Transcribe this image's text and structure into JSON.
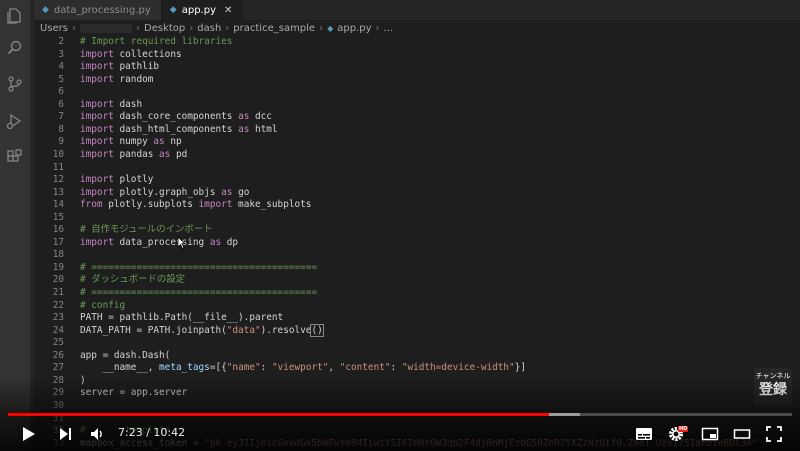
{
  "activity_bar": {
    "icons": [
      "files-icon",
      "search-icon",
      "source-control-icon",
      "run-debug-icon",
      "extensions-icon"
    ]
  },
  "tabs": [
    {
      "label": "data_processing.py",
      "active": false
    },
    {
      "label": "app.py",
      "active": true
    }
  ],
  "breadcrumb": {
    "items": [
      "Users",
      "Desktop",
      "dash",
      "practice_sample",
      "app.py",
      "..."
    ]
  },
  "editor": {
    "lines": [
      {
        "n": "2",
        "t": [
          [
            "cm",
            "# Import required libraries"
          ]
        ]
      },
      {
        "n": "3",
        "t": [
          [
            "kw",
            "import"
          ],
          [
            "pl",
            " collections"
          ]
        ]
      },
      {
        "n": "4",
        "t": [
          [
            "kw",
            "import"
          ],
          [
            "pl",
            " pathlib"
          ]
        ]
      },
      {
        "n": "5",
        "t": [
          [
            "kw",
            "import"
          ],
          [
            "pl",
            " random"
          ]
        ]
      },
      {
        "n": "6",
        "t": []
      },
      {
        "n": "6",
        "t": [
          [
            "kw",
            "import"
          ],
          [
            "pl",
            " dash"
          ]
        ]
      },
      {
        "n": "7",
        "t": [
          [
            "kw",
            "import"
          ],
          [
            "pl",
            " dash_core_components "
          ],
          [
            "kw",
            "as"
          ],
          [
            "pl",
            " dcc"
          ]
        ]
      },
      {
        "n": "8",
        "t": [
          [
            "kw",
            "import"
          ],
          [
            "pl",
            " dash_html_components "
          ],
          [
            "kw",
            "as"
          ],
          [
            "pl",
            " html"
          ]
        ]
      },
      {
        "n": "9",
        "t": [
          [
            "kw",
            "import"
          ],
          [
            "pl",
            " numpy "
          ],
          [
            "kw",
            "as"
          ],
          [
            "pl",
            " np"
          ]
        ]
      },
      {
        "n": "10",
        "t": [
          [
            "kw",
            "import"
          ],
          [
            "pl",
            " pandas "
          ],
          [
            "kw",
            "as"
          ],
          [
            "pl",
            " pd"
          ]
        ]
      },
      {
        "n": "11",
        "t": []
      },
      {
        "n": "12",
        "t": [
          [
            "kw",
            "import"
          ],
          [
            "pl",
            " plotly"
          ]
        ]
      },
      {
        "n": "13",
        "t": [
          [
            "kw",
            "import"
          ],
          [
            "pl",
            " plotly.graph_objs "
          ],
          [
            "kw",
            "as"
          ],
          [
            "pl",
            " go"
          ]
        ]
      },
      {
        "n": "14",
        "t": [
          [
            "kw",
            "from"
          ],
          [
            "pl",
            " plotly.subplots "
          ],
          [
            "kw",
            "import"
          ],
          [
            "pl",
            " make_subplots"
          ]
        ]
      },
      {
        "n": "15",
        "t": []
      },
      {
        "n": "16",
        "t": [
          [
            "cm",
            "# 自作モジュールのインポート"
          ]
        ]
      },
      {
        "n": "17",
        "t": [
          [
            "kw",
            "import"
          ],
          [
            "pl",
            " data_processing "
          ],
          [
            "kw",
            "as"
          ],
          [
            "pl",
            " dp"
          ]
        ]
      },
      {
        "n": "18",
        "t": []
      },
      {
        "n": "19",
        "t": [
          [
            "cm",
            "# ========================================"
          ]
        ]
      },
      {
        "n": "20",
        "t": [
          [
            "cm",
            "# ダッシュボードの設定"
          ]
        ]
      },
      {
        "n": "21",
        "t": [
          [
            "cm",
            "# ========================================"
          ]
        ]
      },
      {
        "n": "22",
        "t": [
          [
            "cm",
            "# config"
          ]
        ]
      },
      {
        "n": "23",
        "t": [
          [
            "pl",
            "PATH = pathlib.Path(__file__).parent"
          ]
        ]
      },
      {
        "n": "24",
        "t": [
          [
            "pl",
            "DATA_PATH = PATH.joinpath("
          ],
          [
            "st",
            "\"data\""
          ],
          [
            "pl",
            ").resolve"
          ],
          [
            "bx",
            "()"
          ]
        ]
      },
      {
        "n": "25",
        "t": []
      },
      {
        "n": "26",
        "t": [
          [
            "pl",
            "app = dash.Dash("
          ]
        ]
      },
      {
        "n": "27",
        "t": [
          [
            "pl",
            "    __name__, "
          ],
          [
            "va",
            "meta_tags"
          ],
          [
            "pl",
            "=[{"
          ],
          [
            "st",
            "\"name\""
          ],
          [
            "pl",
            ": "
          ],
          [
            "st",
            "\"viewport\""
          ],
          [
            "pl",
            ", "
          ],
          [
            "st",
            "\"content\""
          ],
          [
            "pl",
            ": "
          ],
          [
            "st",
            "\"width=device-width\""
          ],
          [
            "pl",
            "}]"
          ]
        ]
      },
      {
        "n": "28",
        "t": [
          [
            "pl",
            ")"
          ]
        ]
      },
      {
        "n": "29",
        "t": [
          [
            "pl",
            "server = app.server"
          ]
        ]
      },
      {
        "n": "30",
        "t": []
      },
      {
        "n": "31",
        "t": []
      },
      {
        "n": "32",
        "t": [
          [
            "cm",
            "# "
          ],
          [
            "cm",
            "      template"
          ]
        ]
      },
      {
        "n": "33",
        "t": [
          [
            "pl",
            "mapbox_access_token = "
          ],
          [
            "st",
            "\"pk.eyJ1IjoicGxvdGx5bWFwYm94IiwiYSI6ImNrOWJqb2F4djBnMjEzbG50ZnR2YXZzNzQifQ.Zme1-Uzoi75IaFbieBDl3A\""
          ]
        ]
      }
    ]
  },
  "watermark": {
    "top": "チャンネル",
    "main": "登録"
  },
  "player": {
    "time_current": "7:23",
    "time_sep": " / ",
    "time_total": "10:42",
    "progress_played": 0.69,
    "progress_loaded": 0.73,
    "hd_badge": "HD"
  }
}
